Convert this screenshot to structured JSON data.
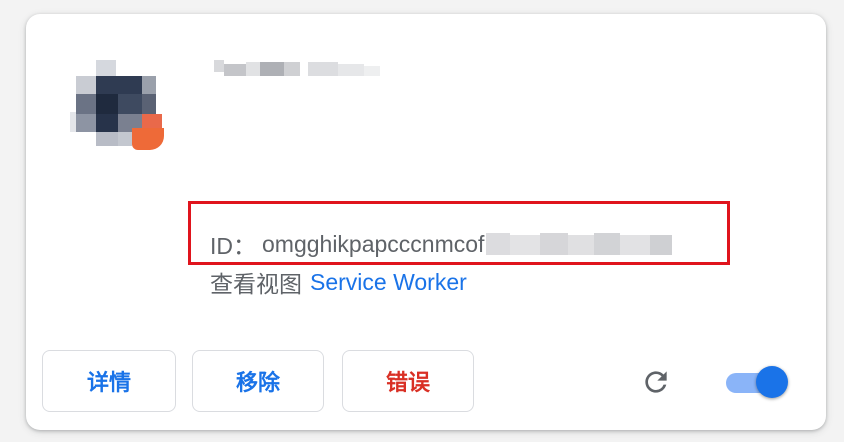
{
  "extension": {
    "id_label": "ID：",
    "id_value": "omgghikpapcccnmcof",
    "views_label": "查看视图",
    "views_link": "Service Worker"
  },
  "actions": {
    "details_label": "详情",
    "remove_label": "移除",
    "errors_label": "错误"
  },
  "controls": {
    "reload_icon": "reload-icon",
    "enabled": true
  },
  "colors": {
    "accent": "#1a73e8",
    "error": "#d93025",
    "highlight": "#e0141d",
    "toggle_track": "#8ab4f8"
  }
}
